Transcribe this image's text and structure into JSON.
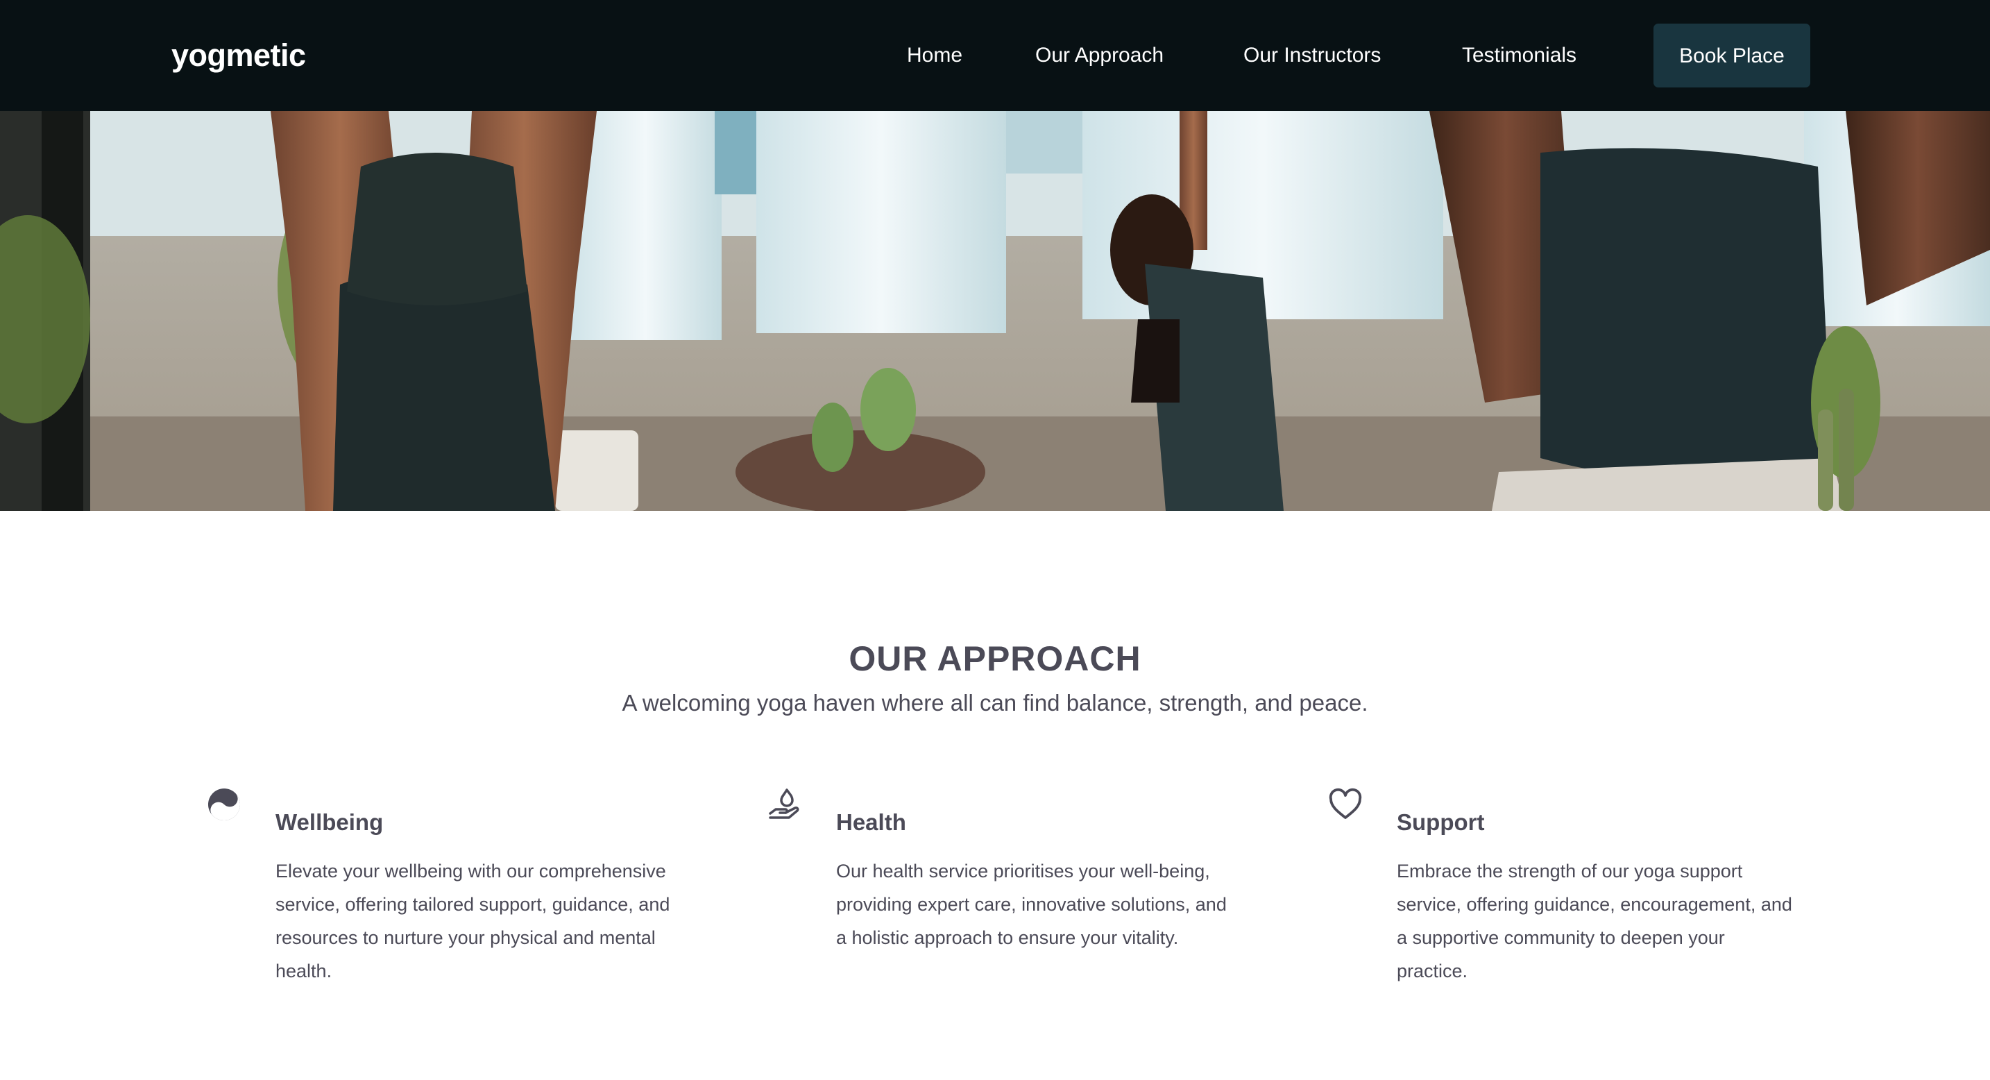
{
  "brand": {
    "name": "yogmetic"
  },
  "nav": {
    "items": [
      {
        "label": "Home"
      },
      {
        "label": "Our Approach"
      },
      {
        "label": "Our Instructors"
      },
      {
        "label": "Testimonials"
      }
    ],
    "cta_label": "Book Place"
  },
  "hero": {
    "image": "yoga-class-photo"
  },
  "approach": {
    "title": "OUR APPROACH",
    "subtitle": "A welcoming yoga haven where all can find balance, strength, and peace.",
    "features": [
      {
        "icon": "yin-yang-icon",
        "title": "Wellbeing",
        "description": "Elevate your wellbeing with our comprehensive service, offering tailored support, guidance, and resources to nurture your physical and mental health."
      },
      {
        "icon": "hand-flame-icon",
        "title": "Health",
        "description": "Our health service prioritises your well-being, providing expert care, innovative solutions, and a holistic approach to ensure your vitality."
      },
      {
        "icon": "heart-icon",
        "title": "Support",
        "description": "Embrace the strength of our yoga support service, offering guidance, encouragement, and a supportive community to deepen your practice."
      }
    ]
  },
  "colors": {
    "navbar_bg": "#081114",
    "button_bg": "#19353f",
    "text_primary": "#4b4a57",
    "background": "#ffffff"
  }
}
